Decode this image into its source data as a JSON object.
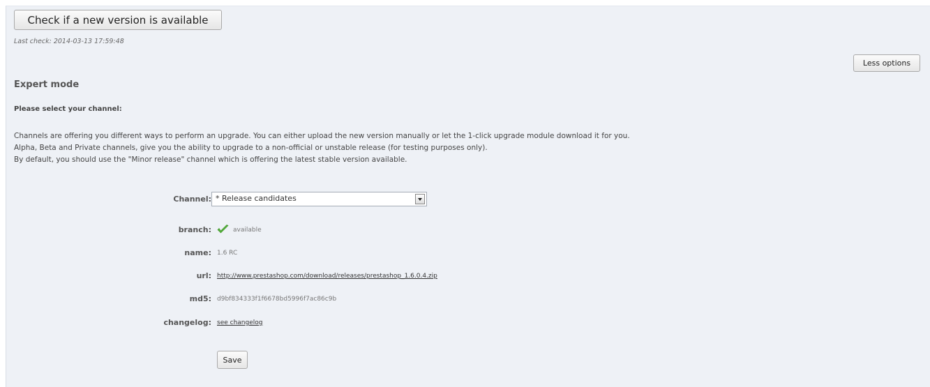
{
  "header": {
    "check_button_label": "Check if a new version is available",
    "last_check": "Last check: 2014-03-13 17:59:48",
    "less_options_label": "Less options"
  },
  "expert": {
    "title": "Expert mode",
    "select_channel": "Please select your channel:",
    "description": [
      "Channels are offering you different ways to perform an upgrade. You can either upload the new version manually or let the 1-click upgrade module download it for you.",
      "Alpha, Beta and Private channels, give you the ability to upgrade to a non-official or unstable release (for testing purposes only).",
      "By default, you should use the \"Minor release\" channel which is offering the latest stable version available."
    ]
  },
  "form": {
    "channel_label": "Channel:",
    "channel_selected": "* Release candidates",
    "branch_label": "branch:",
    "branch_value": "available",
    "branch_icon": "check-icon",
    "name_label": "name:",
    "name_value": "1.6 RC",
    "url_label": "url:",
    "url_value": "http://www.prestashop.com/download/releases/prestashop_1.6.0.4.zip",
    "md5_label": "md5:",
    "md5_value": "d9bf834333f1f6678bd5996f7ac86c9b",
    "changelog_label": "changelog:",
    "changelog_link": "see changelog",
    "save_label": "Save"
  },
  "colors": {
    "panel_background": "#eef1f6",
    "check_green": "#55b33b"
  }
}
